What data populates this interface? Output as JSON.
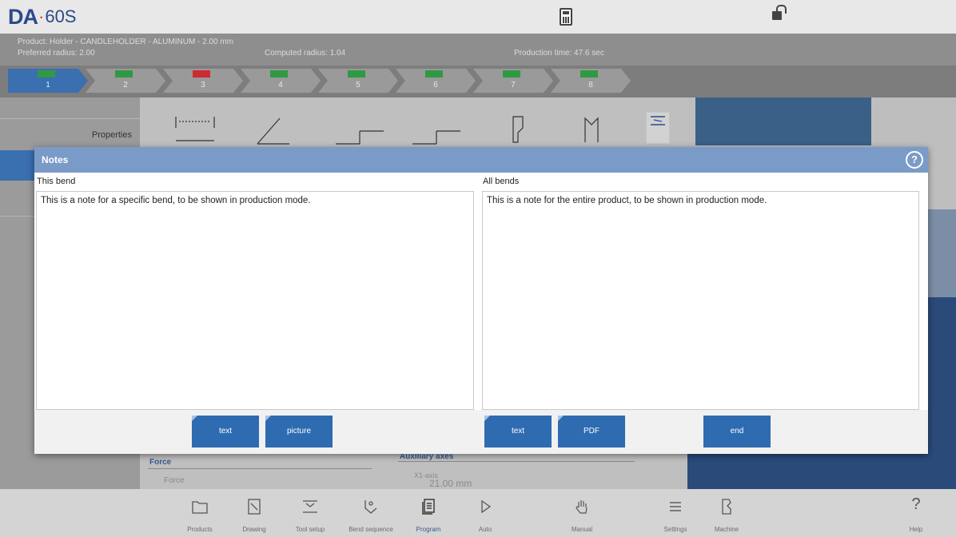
{
  "app": {
    "logo_da": "DA",
    "logo_dot": "·",
    "logo_model": "60S"
  },
  "product": {
    "line": "Product: Holder - CANDLEHOLDER - ALUMINUM - 2.00 mm",
    "preferred_radius": "Preferred radius: 2.00",
    "computed_radius": "Computed radius: 1.04",
    "production_time": "Production time: 47.6 sec"
  },
  "bends": [
    {
      "num": "1",
      "status": "ok",
      "active": true
    },
    {
      "num": "2",
      "status": "ok",
      "active": false
    },
    {
      "num": "3",
      "status": "error",
      "active": false
    },
    {
      "num": "4",
      "status": "ok",
      "active": false
    },
    {
      "num": "5",
      "status": "ok",
      "active": false
    },
    {
      "num": "6",
      "status": "ok",
      "active": false
    },
    {
      "num": "7",
      "status": "ok",
      "active": false
    },
    {
      "num": "8",
      "status": "ok",
      "active": false
    }
  ],
  "left_panel": {
    "properties_label": "Properties"
  },
  "background_fields": {
    "force_header": "Force",
    "force_field": "Force",
    "aux_header": "Auxiliary axes",
    "x1_label": "X1-axis",
    "x1_value": "21.00 mm"
  },
  "modal": {
    "title": "Notes",
    "this_bend_label": "This bend",
    "all_bends_label": "All bends",
    "this_bend_text": "This is a note for a specific bend, to be shown in production mode.",
    "all_bends_text": "This is a note for the entire product, to be shown in production mode.",
    "buttons": {
      "text_left": "text",
      "picture": "picture",
      "text_right": "text",
      "pdf": "PDF",
      "end": "end"
    }
  },
  "bottom_nav": [
    {
      "label": "Products",
      "icon": "folder-icon"
    },
    {
      "label": "Drawing",
      "icon": "pencil-icon"
    },
    {
      "label": "Tool setup",
      "icon": "tool-setup-icon"
    },
    {
      "label": "Bend sequence",
      "icon": "bend-sequence-icon"
    },
    {
      "label": "Program",
      "icon": "program-icon"
    },
    {
      "label": "Auto",
      "icon": "play-icon"
    },
    {
      "label": "Manual",
      "icon": "hand-icon"
    },
    {
      "label": "Settings",
      "icon": "list-icon"
    },
    {
      "label": "Machine",
      "icon": "machine-icon"
    },
    {
      "label": "Help",
      "icon": "help-icon"
    }
  ],
  "colors": {
    "accent": "#2f6bb0",
    "header": "#7a9bc8",
    "ok_flag": "#2f9a43",
    "error_flag": "#cc2b32"
  }
}
